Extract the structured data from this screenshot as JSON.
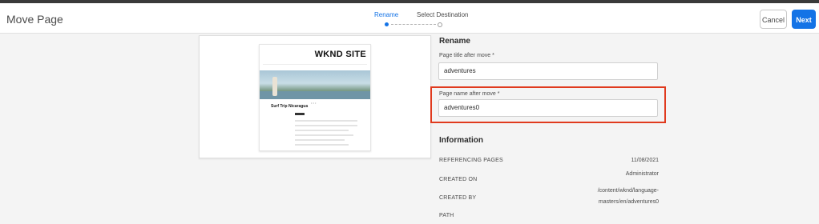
{
  "header": {
    "title": "Move Page",
    "steps": [
      {
        "label": "Rename",
        "active": true
      },
      {
        "label": "Select Destination",
        "active": false
      }
    ],
    "cancel_label": "Cancel",
    "next_label": "Next"
  },
  "preview": {
    "site_logo": "WKND SITE",
    "heading": "Surf Trip Nicaragua"
  },
  "rename": {
    "section_title": "Rename",
    "page_title_label": "Page title after move *",
    "page_title_value": "adventures",
    "page_name_label": "Page name after move *",
    "page_name_value": "adventures0"
  },
  "information": {
    "section_title": "Information",
    "rows": [
      {
        "key": "REFERENCING PAGES",
        "value": "11/08/2021"
      },
      {
        "key": "CREATED ON",
        "value": "Administrator"
      },
      {
        "key": "CREATED BY",
        "value": "/content/wknd/language-masters/en/adventures0"
      },
      {
        "key": "PATH",
        "value": ""
      }
    ]
  },
  "colors": {
    "accent": "#1473e6",
    "highlight": "#e03a1e"
  }
}
